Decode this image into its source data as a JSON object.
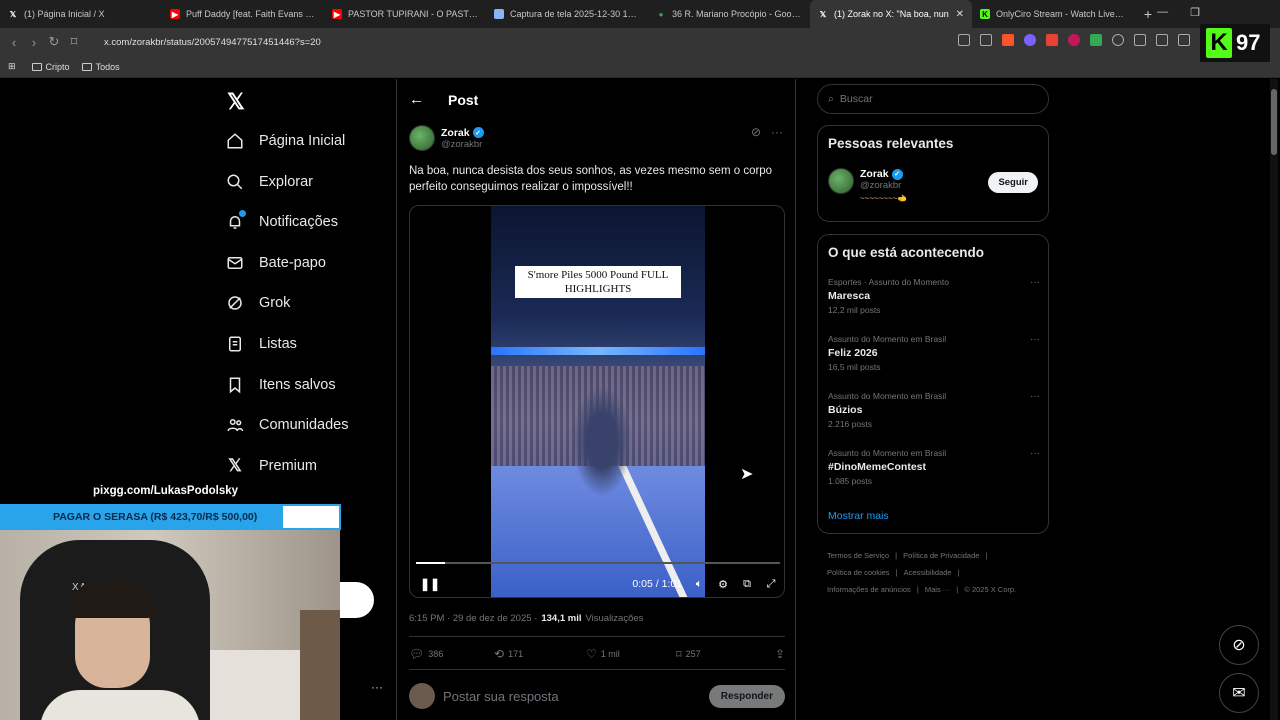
{
  "browser": {
    "tabs": [
      {
        "title": "(1) Página Inicial / X",
        "favicon": "x-icon",
        "color": "#ffffff",
        "active": false
      },
      {
        "title": "Puff Daddy [feat. Faith Evans & 112]",
        "favicon": "youtube-icon",
        "color": "#ff0000",
        "active": false
      },
      {
        "title": "PASTOR TUPIRANI - O PASTOR INCA",
        "favicon": "youtube-icon",
        "color": "#ff0000",
        "active": false
      },
      {
        "title": "Captura de tela 2025-12-30 172756",
        "favicon": "image-icon",
        "color": "#8ab4f8",
        "active": false
      },
      {
        "title": "36 R. Mariano Procópio - Google M",
        "favicon": "maps-icon",
        "color": "#34a853",
        "active": false
      },
      {
        "title": "(1) Zorak no X: \"Na boa, nun",
        "favicon": "x-icon",
        "color": "#ffffff",
        "active": true
      },
      {
        "title": "OnlyCiro Stream - Watch Live on Kic",
        "favicon": "kick-icon",
        "color": "#53fc18",
        "active": false
      }
    ],
    "url": "x.com/zorakbr/status/2005749477517451446?s=20",
    "bookmarks": [
      "Cripto",
      "Todos"
    ],
    "kick_badge": {
      "letter": "K",
      "count": "97"
    }
  },
  "nav": {
    "items": [
      {
        "label": "Página Inicial",
        "icon": "home-icon"
      },
      {
        "label": "Explorar",
        "icon": "search-icon"
      },
      {
        "label": "Notificações",
        "icon": "bell-icon"
      },
      {
        "label": "Bate-papo",
        "icon": "mail-icon"
      },
      {
        "label": "Grok",
        "icon": "grok-icon"
      },
      {
        "label": "Listas",
        "icon": "list-icon"
      },
      {
        "label": "Itens salvos",
        "icon": "bookmark-icon"
      },
      {
        "label": "Comunidades",
        "icon": "people-icon"
      },
      {
        "label": "Premium",
        "icon": "x-icon"
      }
    ]
  },
  "post": {
    "header": "Post",
    "author_name": "Zorak",
    "author_handle": "@zorakbr",
    "text": "Na boa, nunca desista dos seus sonhos, as vezes mesmo sem o corpo perfeito conseguimos realizar o impossível!!",
    "video": {
      "caption": "S'more Piles 5000 Pound FULL HIGHLIGHTS",
      "time": "0:05 / 1:01",
      "progress": 0.08
    },
    "time": "6:15 PM · 29 de dez de 2025 ·",
    "views_count": "134,1 mil",
    "views_label": "Visualizações",
    "stats": {
      "replies": "386",
      "reposts": "171",
      "likes": "1 mil",
      "bookmarks": "257"
    },
    "reply_placeholder": "Postar sua resposta",
    "reply_button": "Responder"
  },
  "sidebar": {
    "search_placeholder": "Buscar",
    "relevant_title": "Pessoas relevantes",
    "relevant": {
      "name": "Zorak",
      "handle": "@zorakbr",
      "bio": "~~~~~~~~🫲",
      "follow_label": "Seguir"
    },
    "trends_title": "O que está acontecendo",
    "trends": [
      {
        "context": "Esportes · Assunto do Momento",
        "topic": "Maresca",
        "count": "12,2 mil posts"
      },
      {
        "context": "Assunto do Momento em Brasil",
        "topic": "Feliz 2026",
        "count": "16,5 mil posts"
      },
      {
        "context": "Assunto do Momento em Brasil",
        "topic": "Búzios",
        "count": "2.216 posts"
      },
      {
        "context": "Assunto do Momento em Brasil",
        "topic": "#DinoMemeContest",
        "count": "1.085 posts"
      }
    ],
    "show_more": "Mostrar mais",
    "footer": [
      "Termos de Serviço",
      "Política de Privacidade",
      "Política de cookies",
      "Acessibilidade",
      "Informações de anúncios",
      "Mais ···",
      "© 2025 X Corp."
    ]
  },
  "overlay": {
    "url": "pixgg.com/LukasPodolsky",
    "bar_text": "PAGAR O SERASA (R$ 423,70/R$ 500,00)",
    "bar_progress": 0.847,
    "chair_text": "XANVM"
  },
  "colors": {
    "accent": "#1d9bf0",
    "kick": "#53fc18",
    "overlay_bar": "#29a3ea"
  }
}
